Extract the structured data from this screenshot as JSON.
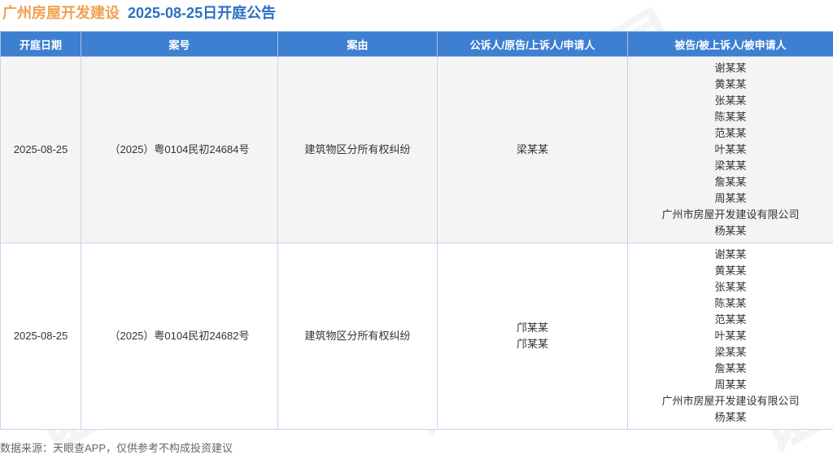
{
  "header": {
    "company": "广州房屋开发建设",
    "date_title": "2025-08-25日开庭公告"
  },
  "table": {
    "columns": [
      "开庭日期",
      "案号",
      "案由",
      "公诉人/原告/上诉人/申请人",
      "被告/被上诉人/被申请人"
    ],
    "rows": [
      {
        "date": "2025-08-25",
        "case_no": "（2025）粤0104民初24684号",
        "cause": "建筑物区分所有权纠纷",
        "plaintiffs": [
          "梁某某"
        ],
        "defendants": [
          "谢某某",
          "黄某某",
          "张某某",
          "陈某某",
          "范某某",
          "叶某某",
          "梁某某",
          "詹某某",
          "周某某",
          "广州市房屋开发建设有限公司",
          "杨某某"
        ]
      },
      {
        "date": "2025-08-25",
        "case_no": "（2025）粤0104民初24682号",
        "cause": "建筑物区分所有权纠纷",
        "plaintiffs": [
          "邝某某",
          "邝某某"
        ],
        "defendants": [
          "谢某某",
          "黄某某",
          "张某某",
          "陈某某",
          "范某某",
          "叶某某",
          "梁某某",
          "詹某某",
          "周某某",
          "广州市房屋开发建设有限公司",
          "杨某某"
        ]
      }
    ]
  },
  "footer": {
    "source": "数据来源：天眼查APP，仅供参考不构成投资建议"
  },
  "watermark": {
    "text": "证券之星"
  }
}
